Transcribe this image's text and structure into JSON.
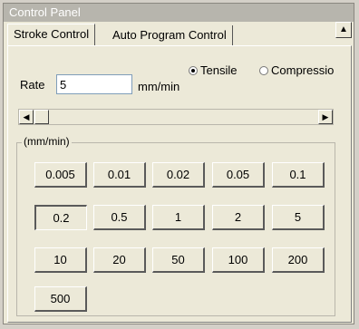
{
  "window": {
    "title": "Control Panel"
  },
  "tabs": [
    {
      "label": "Stroke Control",
      "active": true
    },
    {
      "label": "Auto Program Control",
      "active": false
    }
  ],
  "rate": {
    "label": "Rate",
    "value": "5",
    "unit": "mm/min"
  },
  "mode": {
    "options": [
      "Tensile",
      "Compressio"
    ],
    "selected": "Tensile"
  },
  "slider": {
    "position_fraction": 0.0
  },
  "group": {
    "label": "(mm/min)",
    "buttons": [
      [
        "0.005",
        "0.01",
        "0.02",
        "0.05",
        "0.1"
      ],
      [
        "0.2",
        "0.5",
        "1",
        "2",
        "5"
      ],
      [
        "10",
        "20",
        "50",
        "100",
        "200"
      ],
      [
        "500"
      ]
    ],
    "selected": "0.2"
  }
}
